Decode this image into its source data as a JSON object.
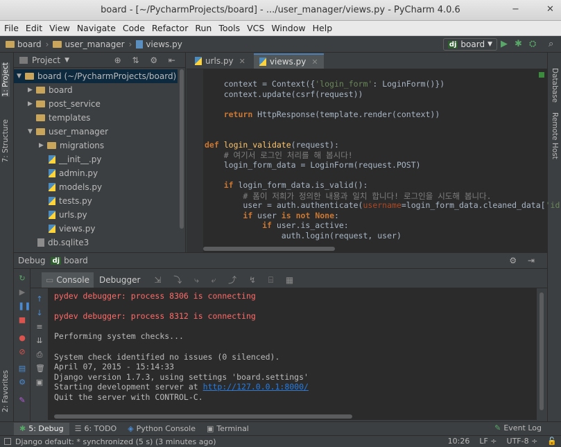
{
  "window": {
    "title": "board - [~/PycharmProjects/board] - .../user_manager/views.py - PyCharm 4.0.6",
    "minimize": "−",
    "close": "✕"
  },
  "menu": [
    "File",
    "Edit",
    "View",
    "Navigate",
    "Code",
    "Refactor",
    "Run",
    "Tools",
    "VCS",
    "Window",
    "Help"
  ],
  "navbar": {
    "crumbs": [
      "board",
      "user_manager",
      "views.py"
    ],
    "run_config_badge": "dj",
    "run_config": "board"
  },
  "left_strip": {
    "project_tab": "1: Project",
    "structure_tab": "7: Structure",
    "favorites_tab": "2: Favorites"
  },
  "right_strip": {
    "database_tab": "Database",
    "remote_host_tab": "Remote Host"
  },
  "project_panel": {
    "title": "Project",
    "root": "board (~/PycharmProjects/board)",
    "items": [
      {
        "label": "board",
        "kind": "folder",
        "expanded": false
      },
      {
        "label": "post_service",
        "kind": "folder",
        "expanded": false
      },
      {
        "label": "templates",
        "kind": "folder",
        "expanded": false
      },
      {
        "label": "user_manager",
        "kind": "folder",
        "expanded": true
      },
      {
        "label": "migrations",
        "kind": "folder",
        "expanded": false
      },
      {
        "label": "__init__.py",
        "kind": "py"
      },
      {
        "label": "admin.py",
        "kind": "py"
      },
      {
        "label": "models.py",
        "kind": "py"
      },
      {
        "label": "tests.py",
        "kind": "py"
      },
      {
        "label": "urls.py",
        "kind": "py"
      },
      {
        "label": "views.py",
        "kind": "py"
      },
      {
        "label": "db.sqlite3",
        "kind": "db"
      }
    ]
  },
  "editor": {
    "tabs": [
      {
        "label": "urls.py",
        "active": false
      },
      {
        "label": "views.py",
        "active": true
      }
    ],
    "lines": [
      "    context = Context({'login_form': LoginForm()})",
      "    context.update(csrf(request))",
      "",
      "    return HttpResponse(template.render(context))",
      "",
      "",
      "def login_validate(request):",
      "    # 여기서 로그인 처리를 해 봅시다!",
      "    login_form_data = LoginForm(request.POST)",
      "",
      "    if login_form_data.is_valid():",
      "        # 폼이 저희가 정의한 내용과 일치 합니다! 로그인을 시도해 봅니다.",
      "        user = auth.authenticate(username=login_form_data.cleaned_data['id'],",
      "        if user is not None:",
      "            if user.is_active:",
      "                auth.login(request, user)"
    ]
  },
  "debug": {
    "label": "Debug",
    "badge": "dj",
    "config": "board",
    "tabs": [
      "Console",
      "Debugger"
    ],
    "console_lines": [
      {
        "text": "pydev debugger: process 8306 is connecting",
        "type": "err"
      },
      {
        "text": "",
        "type": "out"
      },
      {
        "text": "pydev debugger: process 8312 is connecting",
        "type": "err"
      },
      {
        "text": "",
        "type": "out"
      },
      {
        "text": "Performing system checks...",
        "type": "out"
      },
      {
        "text": "",
        "type": "out"
      },
      {
        "text": "System check identified no issues (0 silenced).",
        "type": "out"
      },
      {
        "text": "April 07, 2015 - 15:14:33",
        "type": "out"
      },
      {
        "text": "Django version 1.7.3, using settings 'board.settings'",
        "type": "out"
      },
      {
        "text": "Starting development server at ",
        "type": "out",
        "link": "http://127.0.0.1:8000/"
      },
      {
        "text": "Quit the server with CONTROL-C.",
        "type": "out"
      }
    ]
  },
  "bottom_tabs": [
    {
      "label": "5: Debug",
      "active": true
    },
    {
      "label": "6: TODO",
      "active": false
    },
    {
      "label": "Python Console",
      "active": false
    },
    {
      "label": "Terminal",
      "active": false
    }
  ],
  "event_log": "Event Log",
  "status": {
    "message": "Django default: * synchronized (5 s) (3 minutes ago)",
    "position": "10:26",
    "line_sep": "LF ÷",
    "encoding": "UTF-8 ÷"
  }
}
